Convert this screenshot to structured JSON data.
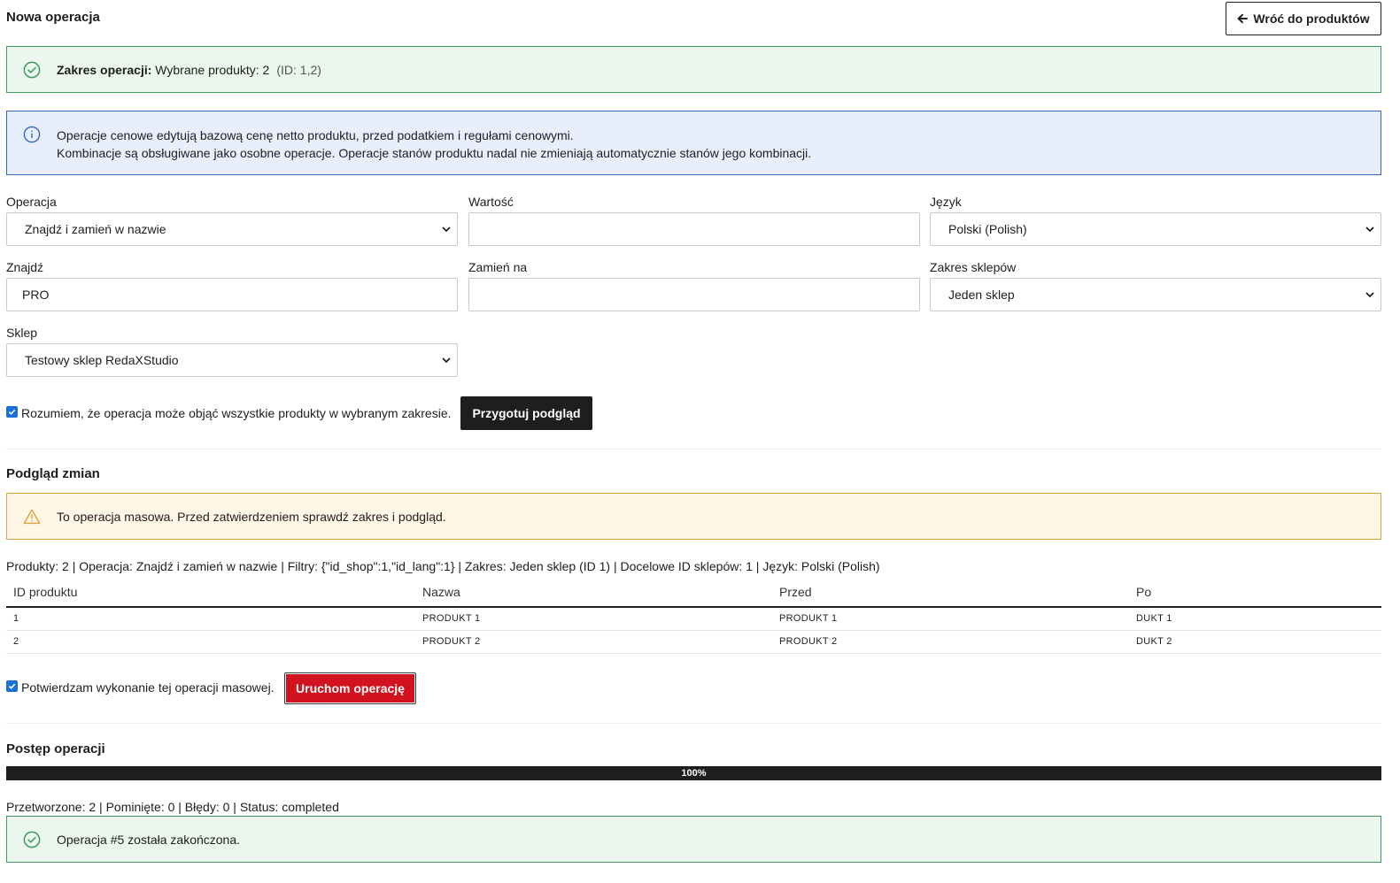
{
  "header": {
    "title": "Nowa operacja",
    "back_button_label": "Wróć do produktów"
  },
  "scope_alert": {
    "label": "Zakres operacji:",
    "text": "Wybrane produkty: 2",
    "ids": "(ID: 1,2)"
  },
  "info_alert": {
    "line1": "Operacje cenowe edytują bazową cenę netto produktu, przed podatkiem i regułami cenowymi.",
    "line2": "Kombinacje są obsługiwane jako osobne operacje. Operacje stanów produktu nadal nie zmieniają automatycznie stanów jego kombinacji."
  },
  "form": {
    "operation": {
      "label": "Operacja",
      "value": "Znajdź i zamień w nazwie"
    },
    "value": {
      "label": "Wartość",
      "value": ""
    },
    "language": {
      "label": "Język",
      "value": "Polski (Polish)"
    },
    "find": {
      "label": "Znajdź",
      "value": "PRO"
    },
    "replace": {
      "label": "Zamień na",
      "value": ""
    },
    "shop_scope": {
      "label": "Zakres sklepów",
      "value": "Jeden sklep"
    },
    "shop": {
      "label": "Sklep",
      "value": "Testowy sklep RedaXStudio"
    }
  },
  "confirm_scope": {
    "label": "Rozumiem, że operacja może objąć wszystkie produkty w wybranym zakresie.",
    "checked": true,
    "button_label": "Przygotuj podgląd"
  },
  "preview": {
    "title": "Podgląd zmian",
    "warning": "To operacja masowa. Przed zatwierdzeniem sprawdź zakres i podgląd.",
    "summary": "Produkty: 2 | Operacja: Znajdź i zamień w nazwie | Filtry: {\"id_shop\":1,\"id_lang\":1} | Zakres: Jeden sklep (ID 1) | Docelowe ID sklepów: 1 | Język: Polski (Polish)",
    "columns": [
      "ID produktu",
      "Nazwa",
      "Przed",
      "Po"
    ],
    "rows": [
      [
        "1",
        "PRODUKT 1",
        "PRODUKT 1",
        "DUKT 1"
      ],
      [
        "2",
        "PRODUKT 2",
        "PRODUKT 2",
        "DUKT 2"
      ]
    ]
  },
  "confirm_run": {
    "label": "Potwierdzam wykonanie tej operacji masowej.",
    "checked": true,
    "button_label": "Uruchom operację"
  },
  "progress": {
    "title": "Postęp operacji",
    "percent_label": "100%",
    "percent": 100,
    "stats": "Przetworzone: 2 | Pominięte: 0 | Błędy: 0 | Status: completed",
    "result_message": "Operacja #5 została zakończona."
  },
  "colors": {
    "success_border": "#3e9b5c",
    "info_border": "#3464c4",
    "warning_border": "#e2a23b",
    "danger_button": "#d3121f",
    "dark": "#1e1e1e"
  },
  "icons": {
    "back": "arrow-left-icon",
    "success": "check-circle-icon",
    "info": "info-circle-icon",
    "warning": "warning-triangle-icon",
    "select": "chevron-down-icon"
  }
}
